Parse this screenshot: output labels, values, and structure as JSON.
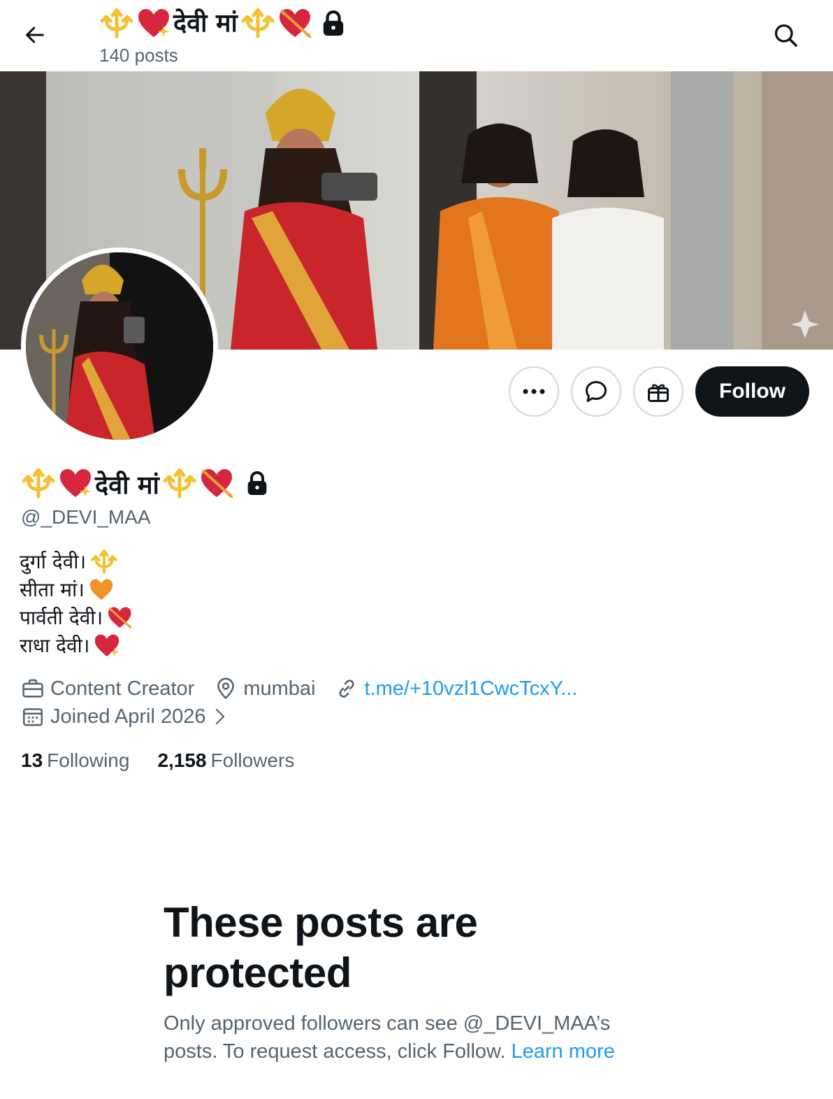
{
  "header": {
    "title": "देवी मां",
    "posts_count": "140 posts"
  },
  "profile": {
    "display_name": "देवी मां",
    "handle": "@_DEVI_MAA",
    "bio": [
      "दुर्गा देवी।",
      "सीता मां।",
      "पार्वती देवी।",
      "राधा देवी।"
    ],
    "category": "Content Creator",
    "location": "mumbai",
    "link": "t.me/+10vzl1CwcTcxY...",
    "joined": "Joined April 2026",
    "following_count": "13",
    "following_label": "Following",
    "followers_count": "2,158",
    "followers_label": "Followers"
  },
  "actions": {
    "follow_label": "Follow"
  },
  "protected": {
    "title": "These posts are protected",
    "text": "Only approved followers can see @_DEVI_MAA’s posts. To request access, click Follow.",
    "learn_more": "Learn more"
  },
  "icons": {
    "back": "arrow-left-icon",
    "search": "search-icon",
    "more": "more-dots-icon",
    "message": "message-icon",
    "gift": "gift-icon",
    "category": "briefcase-icon",
    "location": "location-pin-icon",
    "link": "link-icon",
    "calendar": "calendar-icon",
    "lock": "lock-icon",
    "trident": "trident-emoji",
    "heart": "sparkling-heart-emoji",
    "arrow_heart": "heart-with-arrow-emoji",
    "orange_heart": "orange-heart-emoji"
  },
  "colors": {
    "accent": "#1d9bf0",
    "text": "#0f1419",
    "secondary": "#536471",
    "follow_bg": "#0f1419"
  }
}
